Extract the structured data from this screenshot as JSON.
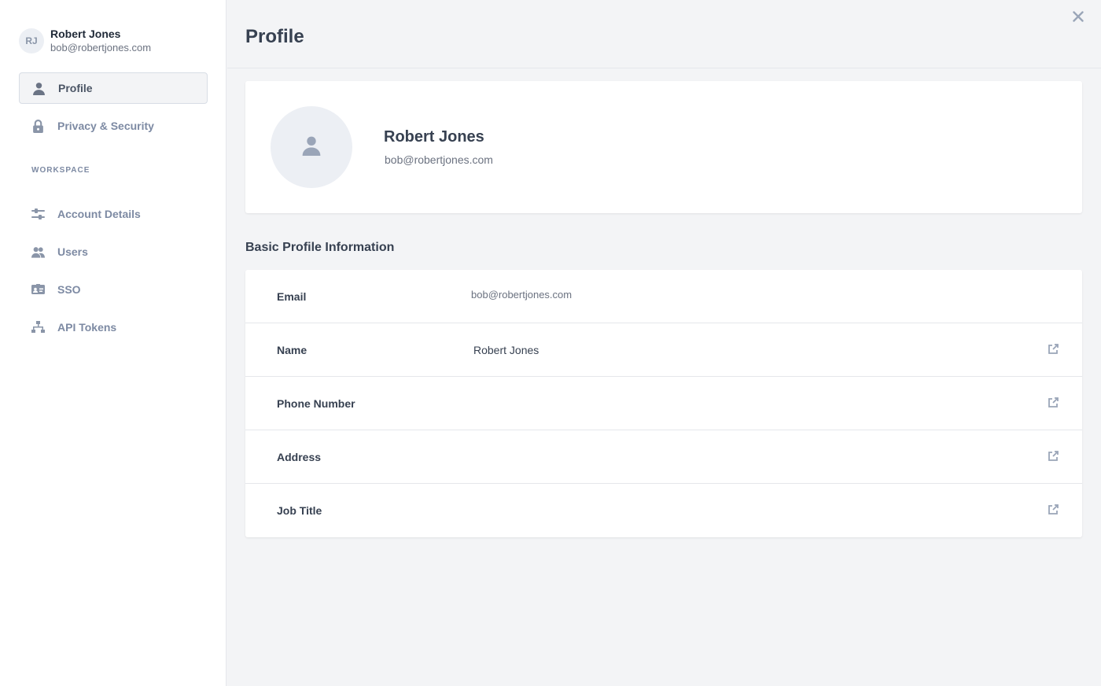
{
  "user": {
    "initials": "RJ",
    "name": "Robert Jones",
    "email": "bob@robertjones.com"
  },
  "sidebar": {
    "items": [
      {
        "label": "Profile",
        "icon": "user-icon",
        "active": true
      },
      {
        "label": "Privacy & Security",
        "icon": "lock-icon",
        "active": false
      }
    ],
    "section_label": "WORKSPACE",
    "workspace_items": [
      {
        "label": "Account Details",
        "icon": "sliders-icon"
      },
      {
        "label": "Users",
        "icon": "users-icon"
      },
      {
        "label": "SSO",
        "icon": "id-card-icon"
      },
      {
        "label": "API Tokens",
        "icon": "hierarchy-icon"
      }
    ]
  },
  "header": {
    "title": "Profile",
    "close_icon": "close-icon"
  },
  "profile_card": {
    "name": "Robert Jones",
    "email": "bob@robertjones.com"
  },
  "basic_info": {
    "title": "Basic Profile Information",
    "rows": [
      {
        "label": "Email",
        "value": "bob@robertjones.com",
        "editable": false
      },
      {
        "label": "Name",
        "value": "Robert Jones",
        "editable": true
      },
      {
        "label": "Phone Number",
        "value": "",
        "editable": true
      },
      {
        "label": "Address",
        "value": "",
        "editable": true
      },
      {
        "label": "Job Title",
        "value": "",
        "editable": true
      }
    ]
  },
  "colors": {
    "sidebar_bg": "#ffffff",
    "main_bg": "#f3f4f6",
    "nav_text": "#7d8aa3",
    "icon": "#8a95a8"
  }
}
